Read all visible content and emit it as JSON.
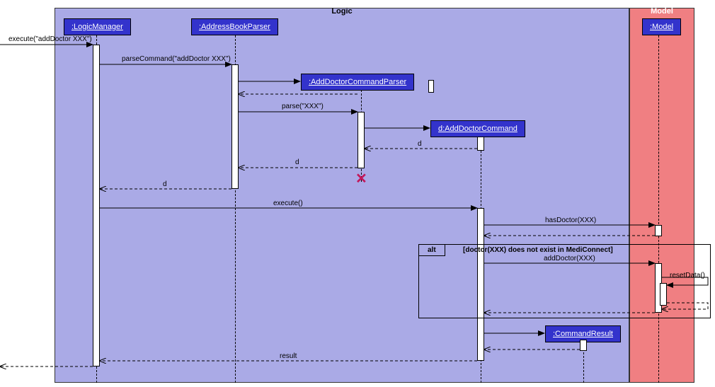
{
  "packages": {
    "logic": "Logic",
    "model": "Model"
  },
  "lifelines": {
    "logicManager": ":LogicManager",
    "parser": ":AddressBookParser",
    "cmdParser": ":AddDoctorCommandParser",
    "cmd": "d:AddDoctorCommand",
    "commandResult": ":CommandResult",
    "model": ":Model"
  },
  "messages": {
    "m1": "execute(\"addDoctor XXX\")",
    "m2": "parseCommand(\"addDoctor XXX\")",
    "m3": "parse(\"XXX\")",
    "m4": "d",
    "m5": "d",
    "m6": "d",
    "m7": "execute()",
    "m8": "hasDoctor(XXX)",
    "m9": "addDoctor(XXX)",
    "m10": "resetData()",
    "m11": "result"
  },
  "fragment": {
    "operator": "alt",
    "guard": "[doctor(XXX) does not exist in MediConnect]"
  },
  "colors": {
    "logicBg": "#aaaae6",
    "modelBg": "#f07f82",
    "header": "#3333cc"
  },
  "chart_data": {
    "type": "sequence-diagram",
    "packages": [
      {
        "name": "Logic",
        "contains": [
          ":LogicManager",
          ":AddressBookParser",
          ":AddDoctorCommandParser",
          "d:AddDoctorCommand",
          ":CommandResult"
        ]
      },
      {
        "name": "Model",
        "contains": [
          ":Model"
        ]
      }
    ],
    "lifelines": [
      {
        "id": "caller",
        "name": "(external)"
      },
      {
        "id": "lm",
        "name": ":LogicManager"
      },
      {
        "id": "abp",
        "name": ":AddressBookParser"
      },
      {
        "id": "adcp",
        "name": ":AddDoctorCommandParser",
        "created_by": "abp",
        "destroyed": true
      },
      {
        "id": "adc",
        "name": "d:AddDoctorCommand",
        "created_by": "adcp"
      },
      {
        "id": "cr",
        "name": ":CommandResult",
        "created_by": "adc"
      },
      {
        "id": "model",
        "name": ":Model"
      }
    ],
    "messages": [
      {
        "from": "caller",
        "to": "lm",
        "label": "execute(\"addDoctor XXX\")",
        "kind": "sync"
      },
      {
        "from": "lm",
        "to": "abp",
        "label": "parseCommand(\"addDoctor XXX\")",
        "kind": "sync"
      },
      {
        "from": "abp",
        "to": "adcp",
        "label": "",
        "kind": "create"
      },
      {
        "from": "adcp",
        "to": "abp",
        "label": "",
        "kind": "return"
      },
      {
        "from": "abp",
        "to": "adcp",
        "label": "parse(\"XXX\")",
        "kind": "sync"
      },
      {
        "from": "adcp",
        "to": "adc",
        "label": "",
        "kind": "create"
      },
      {
        "from": "adc",
        "to": "adcp",
        "label": "d",
        "kind": "return"
      },
      {
        "from": "adcp",
        "to": "abp",
        "label": "d",
        "kind": "return"
      },
      {
        "from": "abp",
        "to": "lm",
        "label": "d",
        "kind": "return"
      },
      {
        "from": "lm",
        "to": "adc",
        "label": "execute()",
        "kind": "sync"
      },
      {
        "from": "adc",
        "to": "model",
        "label": "hasDoctor(XXX)",
        "kind": "sync"
      },
      {
        "from": "model",
        "to": "adc",
        "label": "",
        "kind": "return"
      },
      {
        "fragment": "alt",
        "guard": "[doctor(XXX) does not exist in MediConnect]",
        "messages": [
          {
            "from": "adc",
            "to": "model",
            "label": "addDoctor(XXX)",
            "kind": "sync"
          },
          {
            "from": "model",
            "to": "model",
            "label": "resetData()",
            "kind": "self"
          },
          {
            "from": "model",
            "to": "model",
            "label": "",
            "kind": "return-self"
          },
          {
            "from": "model",
            "to": "adc",
            "label": "",
            "kind": "return"
          }
        ]
      },
      {
        "from": "adc",
        "to": "cr",
        "label": "",
        "kind": "create"
      },
      {
        "from": "cr",
        "to": "adc",
        "label": "",
        "kind": "return"
      },
      {
        "from": "adc",
        "to": "lm",
        "label": "result",
        "kind": "return"
      },
      {
        "from": "lm",
        "to": "caller",
        "label": "",
        "kind": "return"
      }
    ]
  }
}
